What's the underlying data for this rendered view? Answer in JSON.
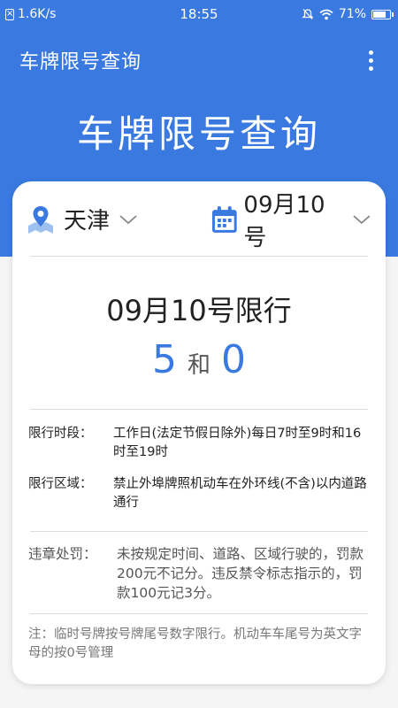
{
  "status_bar": {
    "network_speed": "1.6K/s",
    "time": "18:55",
    "battery": "71%"
  },
  "app_bar": {
    "title": "车牌限号查询"
  },
  "hero": {
    "title": "车牌限号查询"
  },
  "selector": {
    "city": "天津",
    "date": "09月10号"
  },
  "result": {
    "title": "09月10号限行",
    "num1": "5",
    "and": "和",
    "num2": "0"
  },
  "rules": {
    "time_label": "限行时段：",
    "time_value": "工作日(法定节假日除外)每日7时至9时和16时至19时",
    "area_label": "限行区域：",
    "area_value": "禁止外埠牌照机动车在外环线(不含)以内道路通行",
    "penalty_label": "违章处罚：",
    "penalty_value": "未按规定时间、道路、区域行驶的，罚款200元不记分。违反禁令标志指示的，罚款100元记3分。",
    "note": "注：临时号牌按号牌尾号数字限行。机动车车尾号为英文字母的按0号管理"
  },
  "colors": {
    "primary": "#3a7ae0",
    "background": "#f5f5f5"
  }
}
